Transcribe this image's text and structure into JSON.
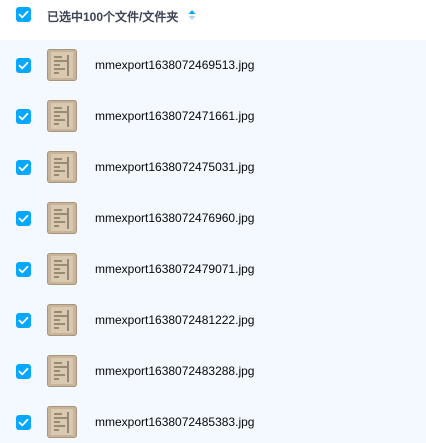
{
  "header": {
    "selection_text": "已选中100个文件/文件夹",
    "checked": true
  },
  "colors": {
    "accent": "#06a7ff",
    "list_background": "#f3f9ff",
    "text_primary": "#06070a",
    "text_secondary": "#3c4455"
  },
  "files": [
    {
      "name": "mmexport1638072469513.jpg",
      "checked": true,
      "icon": "image-thumbnail-icon"
    },
    {
      "name": "mmexport1638072471661.jpg",
      "checked": true,
      "icon": "image-thumbnail-icon"
    },
    {
      "name": "mmexport1638072475031.jpg",
      "checked": true,
      "icon": "image-thumbnail-icon"
    },
    {
      "name": "mmexport1638072476960.jpg",
      "checked": true,
      "icon": "image-thumbnail-icon"
    },
    {
      "name": "mmexport1638072479071.jpg",
      "checked": true,
      "icon": "image-thumbnail-icon"
    },
    {
      "name": "mmexport1638072481222.jpg",
      "checked": true,
      "icon": "image-thumbnail-icon"
    },
    {
      "name": "mmexport1638072483288.jpg",
      "checked": true,
      "icon": "image-thumbnail-icon"
    },
    {
      "name": "mmexport1638072485383.jpg",
      "checked": true,
      "icon": "image-thumbnail-icon"
    }
  ]
}
